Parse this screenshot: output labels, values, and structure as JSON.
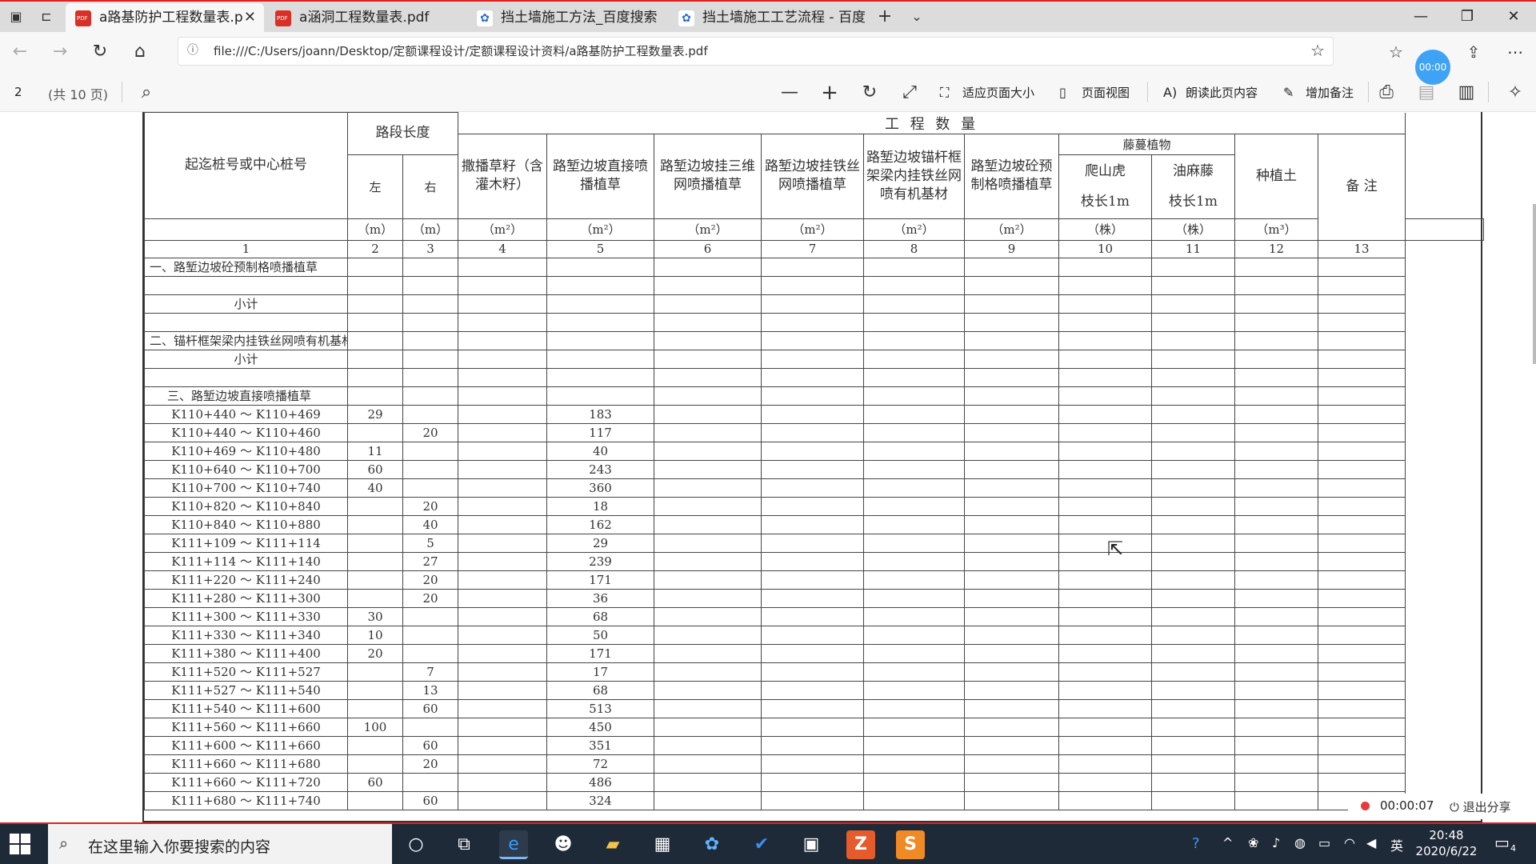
{
  "browser": {
    "tabs": [
      {
        "title": "a路基防护工程数量表.p",
        "icon": "pdf-icon",
        "active": true
      },
      {
        "title": "a涵洞工程数量表.pdf",
        "icon": "pdf-icon",
        "active": false
      },
      {
        "title": "挡土墙施工方法_百度搜索",
        "icon": "baidu-icon",
        "active": false
      },
      {
        "title": "挡土墙施工工艺流程 - 百度",
        "icon": "baidu-icon",
        "active": false
      }
    ],
    "url": "file:///C:/Users/joann/Desktop/定额课程设计/定额课程设计资料/a路基防护工程数量表.pdf",
    "timer_badge": "00:00"
  },
  "pdf_toolbar": {
    "page": "2",
    "total": "(共 10 页)",
    "fit_page": "适应页面大小",
    "page_view": "页面视图",
    "read_aloud": "朗读此页内容",
    "add_note": "增加备注"
  },
  "table": {
    "header": {
      "start_col": "起迄桩号或中心桩号",
      "segment_length": "路段长度",
      "left": "左",
      "right": "右",
      "quantity": "工 程 数 量",
      "col4": "撒播草籽（含灌木籽）",
      "col5": "路堑边坡直接喷播植草",
      "col6": "路堑边坡挂三维网喷播植草",
      "col7": "路堑边坡挂铁丝网喷播植草",
      "col8": "路堑边坡锚杆框架梁内挂铁丝网喷有机基材",
      "col9": "路堑边坡砼预制格喷播植草",
      "vines": "藤蔓植物",
      "col10": "爬山虎",
      "col10b": "枝长1m",
      "col11": "油麻藤",
      "col11b": "枝长1m",
      "col12": "种植土",
      "col13": "备 注"
    },
    "units": [
      "（m）",
      "（m）",
      "（m²）",
      "（m²）",
      "（m²）",
      "（m²）",
      "（m²）",
      "（m²）",
      "（株）",
      "（株）",
      "（m³）"
    ],
    "col_numbers": [
      "1",
      "2",
      "3",
      "4",
      "5",
      "6",
      "7",
      "8",
      "9",
      "10",
      "11",
      "12",
      "13"
    ],
    "section1": "一、路堑边坡砼预制格喷播植草",
    "subtotal": "小计",
    "section2": "二、锚杆框架梁内挂铁丝网喷有机基材",
    "section3": "三、路堑边坡直接喷播植草",
    "rows": [
      {
        "station": "K110+440 ～ K110+469",
        "left": "29",
        "right": "",
        "c5": "183"
      },
      {
        "station": "K110+440 ～ K110+460",
        "left": "",
        "right": "20",
        "c5": "117"
      },
      {
        "station": "K110+469 ～ K110+480",
        "left": "11",
        "right": "",
        "c5": "40"
      },
      {
        "station": "K110+640 ～ K110+700",
        "left": "60",
        "right": "",
        "c5": "243"
      },
      {
        "station": "K110+700 ～ K110+740",
        "left": "40",
        "right": "",
        "c5": "360"
      },
      {
        "station": "K110+820 ～ K110+840",
        "left": "",
        "right": "20",
        "c5": "18"
      },
      {
        "station": "K110+840 ～ K110+880",
        "left": "",
        "right": "40",
        "c5": "162"
      },
      {
        "station": "K111+109 ～ K111+114",
        "left": "",
        "right": "5",
        "c5": "29"
      },
      {
        "station": "K111+114 ～ K111+140",
        "left": "",
        "right": "27",
        "c5": "239"
      },
      {
        "station": "K111+220 ～ K111+240",
        "left": "",
        "right": "20",
        "c5": "171"
      },
      {
        "station": "K111+280 ～ K111+300",
        "left": "",
        "right": "20",
        "c5": "36"
      },
      {
        "station": "K111+300 ～ K111+330",
        "left": "30",
        "right": "",
        "c5": "68"
      },
      {
        "station": "K111+330 ～ K111+340",
        "left": "10",
        "right": "",
        "c5": "50"
      },
      {
        "station": "K111+380 ～ K111+400",
        "left": "20",
        "right": "",
        "c5": "171"
      },
      {
        "station": "K111+520 ～ K111+527",
        "left": "",
        "right": "7",
        "c5": "17"
      },
      {
        "station": "K111+527 ～ K111+540",
        "left": "",
        "right": "13",
        "c5": "68"
      },
      {
        "station": "K111+540 ～ K111+600",
        "left": "",
        "right": "60",
        "c5": "513"
      },
      {
        "station": "K111+560 ～ K111+660",
        "left": "100",
        "right": "",
        "c5": "450"
      },
      {
        "station": "K111+600 ～ K111+660",
        "left": "",
        "right": "60",
        "c5": "351"
      },
      {
        "station": "K111+660 ～ K111+680",
        "left": "",
        "right": "20",
        "c5": "72"
      },
      {
        "station": "K111+660 ～ K111+720",
        "left": "60",
        "right": "",
        "c5": "486"
      },
      {
        "station": "K111+680 ～ K111+740",
        "left": "",
        "right": "60",
        "c5": "324"
      }
    ]
  },
  "recording": {
    "time": "00:00:07",
    "exit": "退出分享"
  },
  "taskbar": {
    "search_placeholder": "在这里输入你要搜索的内容",
    "ime": "英",
    "time": "20:48",
    "date": "2020/6/22",
    "notifications": "4"
  }
}
